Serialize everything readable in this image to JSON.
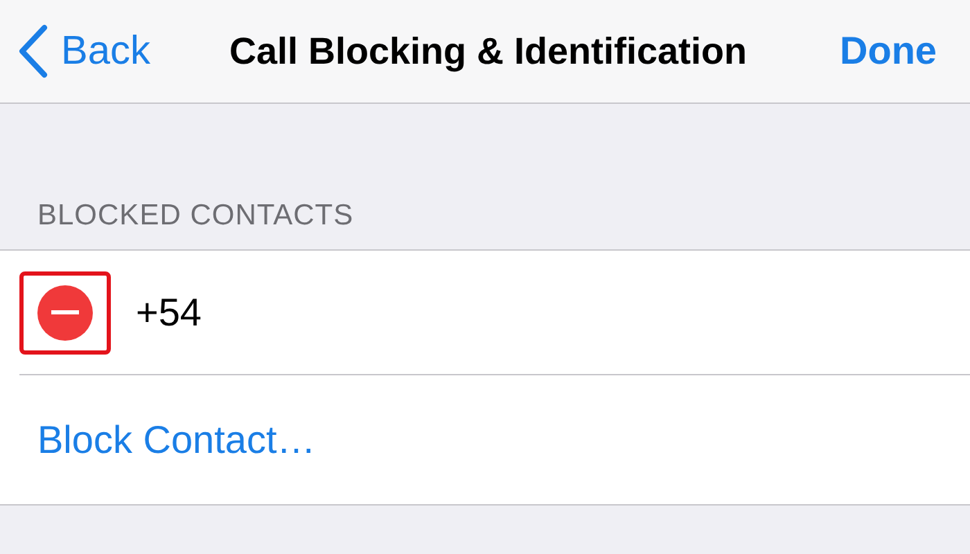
{
  "nav": {
    "back": "Back",
    "title": "Call Blocking & Identification",
    "done": "Done"
  },
  "section": {
    "header": "BLOCKED CONTACTS",
    "contacts": [
      {
        "number": "+54",
        "highlighted": true
      }
    ],
    "action": "Block Contact…"
  }
}
